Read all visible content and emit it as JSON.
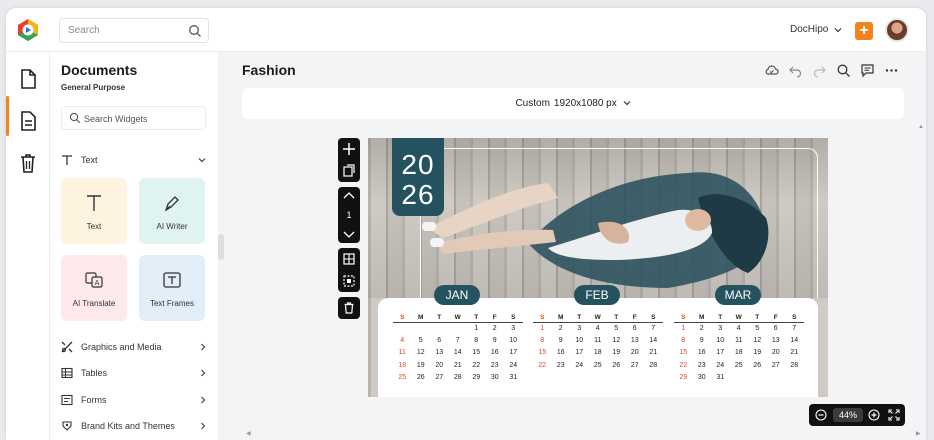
{
  "app": {
    "search_placeholder": "Search",
    "account": "DocHipo"
  },
  "panel": {
    "title": "Documents",
    "subtitle": "General Purpose",
    "search_placeholder": "Search Widgets",
    "text_section": "Text",
    "tiles": [
      {
        "label": "Text",
        "bg": "#fdf3df"
      },
      {
        "label": "AI Writer",
        "bg": "#dff3f1"
      },
      {
        "label": "AI Translate",
        "bg": "#fde9e9"
      },
      {
        "label": "Text Frames",
        "bg": "#e1edf7"
      }
    ],
    "sections": [
      "Graphics and Media",
      "Tables",
      "Forms",
      "Brand Kits and Themes"
    ]
  },
  "editor": {
    "doc_title": "Fashion",
    "size_label": "Custom",
    "size_value": "1920x1080 px",
    "page_number": "1",
    "zoom": "44%"
  },
  "calendar": {
    "year_top": "20",
    "year_bottom": "26",
    "weekdays": [
      "S",
      "M",
      "T",
      "W",
      "T",
      "F",
      "S"
    ],
    "months": [
      {
        "name": "JAN",
        "weeks": [
          [
            "",
            "",
            "",
            "",
            "1",
            "2",
            "3"
          ],
          [
            "4",
            "5",
            "6",
            "7",
            "8",
            "9",
            "10"
          ],
          [
            "11",
            "12",
            "13",
            "14",
            "15",
            "16",
            "17"
          ],
          [
            "18",
            "19",
            "20",
            "21",
            "22",
            "23",
            "24"
          ],
          [
            "25",
            "26",
            "27",
            "28",
            "29",
            "30",
            "31"
          ]
        ]
      },
      {
        "name": "FEB",
        "weeks": [
          [
            "1",
            "2",
            "3",
            "4",
            "5",
            "6",
            "7"
          ],
          [
            "8",
            "9",
            "10",
            "11",
            "12",
            "13",
            "14"
          ],
          [
            "15",
            "16",
            "17",
            "18",
            "19",
            "20",
            "21"
          ],
          [
            "22",
            "23",
            "24",
            "25",
            "26",
            "27",
            "28"
          ],
          [
            "",
            "",
            "",
            "",
            "",
            "",
            ""
          ]
        ]
      },
      {
        "name": "MAR",
        "weeks": [
          [
            "1",
            "2",
            "3",
            "4",
            "5",
            "6",
            "7"
          ],
          [
            "8",
            "9",
            "10",
            "11",
            "12",
            "13",
            "14"
          ],
          [
            "15",
            "16",
            "17",
            "18",
            "19",
            "20",
            "21"
          ],
          [
            "22",
            "23",
            "24",
            "25",
            "26",
            "27",
            "28"
          ],
          [
            "29",
            "30",
            "31",
            "",
            "",
            "",
            ""
          ]
        ]
      }
    ]
  },
  "colors": {
    "accent": "#f58220",
    "calendar_teal": "#24535f",
    "sunday_red": "#e0491e"
  }
}
